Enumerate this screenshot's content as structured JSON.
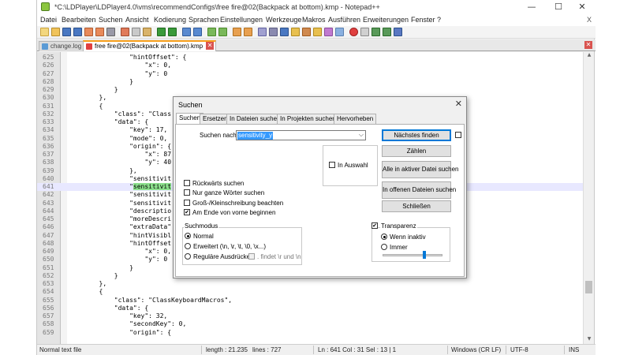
{
  "window": {
    "title": "*C:\\LDPlayer\\LDPlayer4.0\\vms\\recommendConfigs\\free fire@02(Backpack at bottom).kmp - Notepad++",
    "minimize": "—",
    "maximize": "☐",
    "close": "✕"
  },
  "menu": {
    "items": [
      "Datei",
      "Bearbeiten",
      "Suchen",
      "Ansicht",
      "Kodierung",
      "Sprachen",
      "Einstellungen",
      "Werkzeuge",
      "Makros",
      "Ausführen",
      "Erweiterungen",
      "Fenster",
      "?"
    ],
    "close_x": "X"
  },
  "tabs": [
    {
      "label": "change.log",
      "active": false,
      "icon_color": "#5b9bd5"
    },
    {
      "label": "free fire@02(Backpack at bottom).kmp",
      "active": true,
      "icon_color": "#e04040"
    }
  ],
  "editor": {
    "lines": [
      {
        "n": "625",
        "t": "                \"hintOffset\": {"
      },
      {
        "n": "626",
        "t": "                    \"x\": 0,"
      },
      {
        "n": "627",
        "t": "                    \"y\": 0"
      },
      {
        "n": "628",
        "t": "                }"
      },
      {
        "n": "629",
        "t": "            }"
      },
      {
        "n": "630",
        "t": "        },"
      },
      {
        "n": "631",
        "t": "        {"
      },
      {
        "n": "632",
        "t": "            \"class\": \"Class"
      },
      {
        "n": "633",
        "t": "            \"data\": {"
      },
      {
        "n": "634",
        "t": "                \"key\": 17,"
      },
      {
        "n": "635",
        "t": "                \"mode\": 0,"
      },
      {
        "n": "636",
        "t": "                \"origin\": {"
      },
      {
        "n": "637",
        "t": "                    \"x\": 87"
      },
      {
        "n": "638",
        "t": "                    \"y\": 40"
      },
      {
        "n": "639",
        "t": "                },"
      },
      {
        "n": "640",
        "t": "                \"sensitivit"
      },
      {
        "n": "641",
        "t": "                \"",
        "hl": "sensitivit",
        "cur": true
      },
      {
        "n": "642",
        "t": "                \"sensitivit"
      },
      {
        "n": "643",
        "t": "                \"sensitivit"
      },
      {
        "n": "644",
        "t": "                \"descriptio"
      },
      {
        "n": "645",
        "t": "                \"moreDescri"
      },
      {
        "n": "646",
        "t": "                \"extraData\""
      },
      {
        "n": "647",
        "t": "                \"hintVisibl"
      },
      {
        "n": "648",
        "t": "                \"hintOffset"
      },
      {
        "n": "649",
        "t": "                    \"x\": 0,"
      },
      {
        "n": "650",
        "t": "                    \"y\": 0"
      },
      {
        "n": "651",
        "t": "                }"
      },
      {
        "n": "652",
        "t": "            }"
      },
      {
        "n": "653",
        "t": "        },"
      },
      {
        "n": "654",
        "t": "        {"
      },
      {
        "n": "655",
        "t": "            \"class\": \"ClassKeyboardMacros\","
      },
      {
        "n": "656",
        "t": "            \"data\": {"
      },
      {
        "n": "657",
        "t": "                \"key\": 32,"
      },
      {
        "n": "658",
        "t": "                \"secondKey\": 0,"
      },
      {
        "n": "659",
        "t": "                \"origin\": {"
      }
    ]
  },
  "status": {
    "filetype": "Normal text file",
    "length": "length : 21.235",
    "lines": "lines : 727",
    "position": "Ln : 641   Col : 31   Sel : 13 | 1",
    "eol": "Windows (CR LF)",
    "encoding": "UTF-8",
    "mode": "INS"
  },
  "dialog": {
    "title": "Suchen",
    "close": "✕",
    "tabs": [
      "Suchen",
      "Ersetzen",
      "In Dateien suchen",
      "In Projekten suchen",
      "Hervorheben"
    ],
    "search_label": "Suchen nach:",
    "search_value": "sensitivity_y",
    "dropdown_arrow": "⌵",
    "buttons": {
      "find_next": "Nächstes finden",
      "count": "Zählen",
      "find_all_current": "Alle in aktiver Datei suchen",
      "find_all_open": "In offenen Dateien suchen",
      "close": "Schließen"
    },
    "in_selection": "In Auswahl",
    "options": [
      {
        "label": "Rückwärts suchen",
        "checked": false
      },
      {
        "label": "Nur ganze Wörter suchen",
        "checked": false
      },
      {
        "label": "Groß-/Kleinschreibung beachten",
        "checked": false
      },
      {
        "label": "Am Ende von vorne beginnen",
        "checked": true
      }
    ],
    "search_mode": {
      "title": "Suchmodus",
      "normal": "Normal",
      "extended": "Erweitert (\\n, \\r, \\t, \\0, \\x...)",
      "regex": "Reguläre Ausdrücke",
      "dot_newline": ". findet \\r und \\n"
    },
    "transparency": {
      "title": "Transparenz",
      "checked": true,
      "on_inactive": "Wenn inaktiv",
      "always": "Immer",
      "level": 0.7
    },
    "check_mark": "✔"
  },
  "colors": {
    "highlight": "#8ce08c",
    "accent": "#0078d7",
    "tab_active_border": "#f8a01c"
  }
}
